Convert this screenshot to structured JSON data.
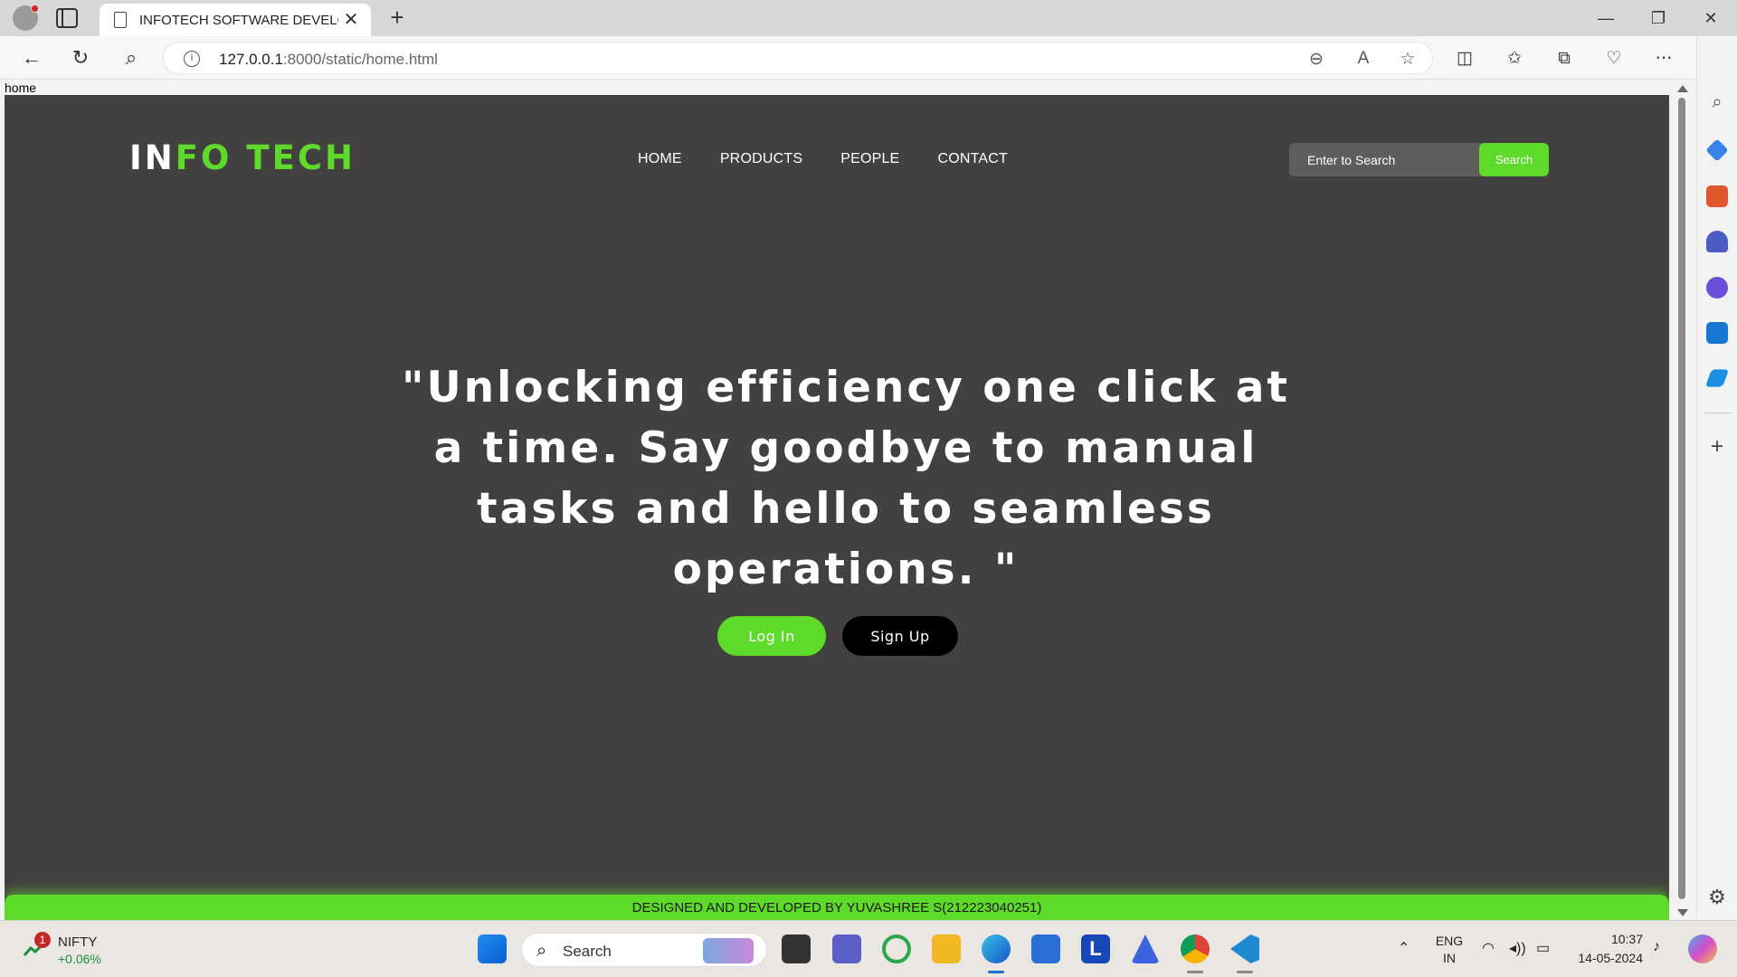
{
  "browser": {
    "tab_title": "INFOTECH SOFTWARE DEVELOPER",
    "tab_close": "✕",
    "new_tab": "+",
    "url_host": "127.0.0.1",
    "url_path": ":8000/static/home.html",
    "status_word": "home"
  },
  "site": {
    "logo_part1": "IN",
    "logo_part2": "FO",
    "logo_part3": "TECH",
    "nav": [
      "HOME",
      "PRODUCTS",
      "PEOPLE",
      "CONTACT"
    ],
    "search_placeholder": "Enter to Search",
    "search_button": "Search",
    "hero_text": "\"Unlocking efficiency one click at a time. Say goodbye to manual tasks and hello to seamless operations. \"",
    "login_label": "Log In",
    "signup_label": "Sign Up",
    "footer_text": "DESIGNED AND DEVELOPED BY YUVASHREE S(212223040251)",
    "colors": {
      "background": "#434040",
      "accent": "#5edb2a",
      "signup": "#000000"
    }
  },
  "taskbar": {
    "stock_name": "NIFTY",
    "stock_change": "+0.06%",
    "stock_badge": "1",
    "search_label": "Search",
    "lang_top": "ENG",
    "lang_bottom": "IN",
    "time": "10:37",
    "date": "14-05-2024"
  }
}
